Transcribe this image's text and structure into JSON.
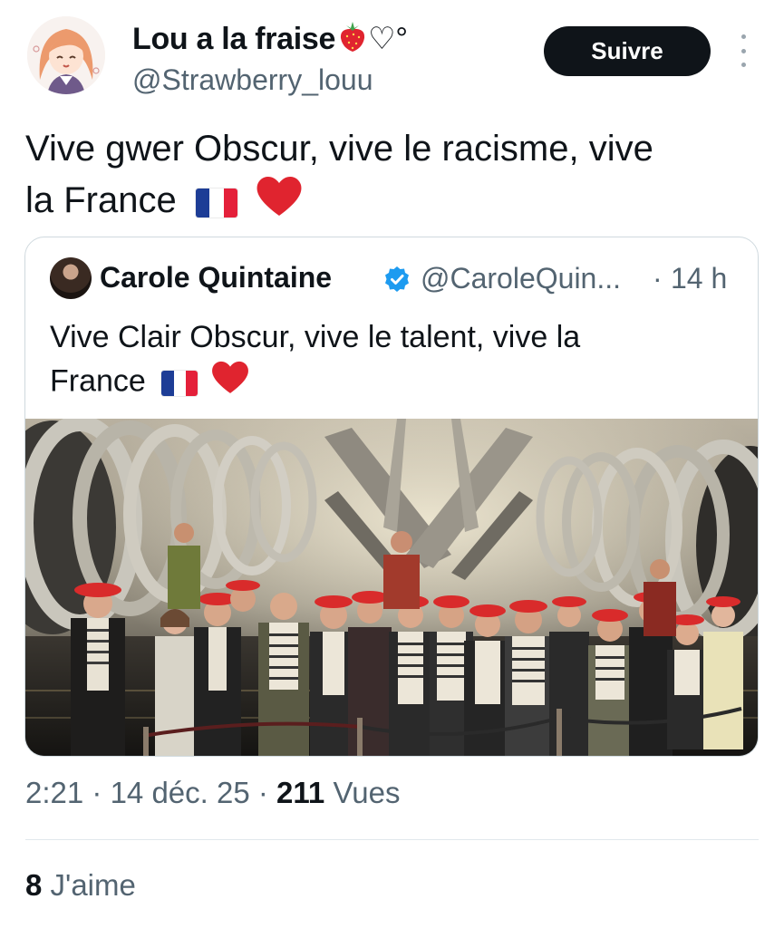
{
  "author": {
    "display_name": "Lou a la fraise",
    "name_suffix": "♡°",
    "handle": "@Strawberry_louu"
  },
  "follow_label": "Suivre",
  "tweet": {
    "text_line1": "Vive gwer Obscur, vive le racisme, vive",
    "text_line2": "la France"
  },
  "quoted": {
    "display_name": "Carole Quintaine",
    "handle": "@CaroleQuin...",
    "separator": "·",
    "time": "14 h",
    "text_line1": "Vive Clair Obscur, vive le talent, vive la",
    "text_line2": "France"
  },
  "meta": {
    "time": "2:21",
    "date": "14 déc. 25",
    "views_count": "211",
    "views_label": "Vues"
  },
  "likes": {
    "count": "8",
    "label": "J'aime"
  },
  "colors": {
    "text": "#0f1419",
    "secondary": "#536471",
    "verified": "#1d9bf0",
    "follow_bg": "#0f1419",
    "heart": "#e0242f",
    "flag_blue": "#1d3d96",
    "flag_red": "#e4203a"
  },
  "icons": [
    "strawberry-icon",
    "heart-outline-icon",
    "more-icon",
    "verified-icon",
    "french-flag-icon",
    "red-heart-icon"
  ]
}
